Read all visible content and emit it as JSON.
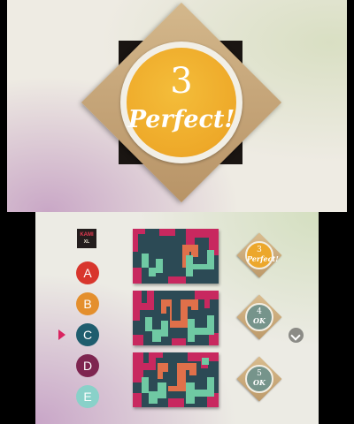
{
  "result": {
    "moves": "3",
    "rating": "Perfect!"
  },
  "chapters": {
    "logo_text": "KAMI",
    "logo_sub": "XL",
    "items": [
      "A",
      "B",
      "C",
      "D",
      "E"
    ],
    "selected": "C",
    "colors": [
      "#d8362d",
      "#e48f2d",
      "#1f5d6e",
      "#7e2550",
      "#89d1c9"
    ]
  },
  "puzzles": [
    {
      "moves": "3",
      "rating": "Perfect!",
      "status": "perfect"
    },
    {
      "moves": "4",
      "rating": "OK",
      "status": "ok"
    },
    {
      "moves": "5",
      "rating": "OK",
      "status": "ok"
    }
  ],
  "colors": {
    "puzzle_background": "#2c4a55",
    "puzzle_pink": "#c8285f",
    "puzzle_orange": "#e0704a",
    "puzzle_green": "#6fc9a3",
    "badge_gold": "#eca72c",
    "badge_teal": "#76948b"
  },
  "icons": {
    "scroll": "chevron-down-icon",
    "selector": "triangle-right-icon"
  }
}
